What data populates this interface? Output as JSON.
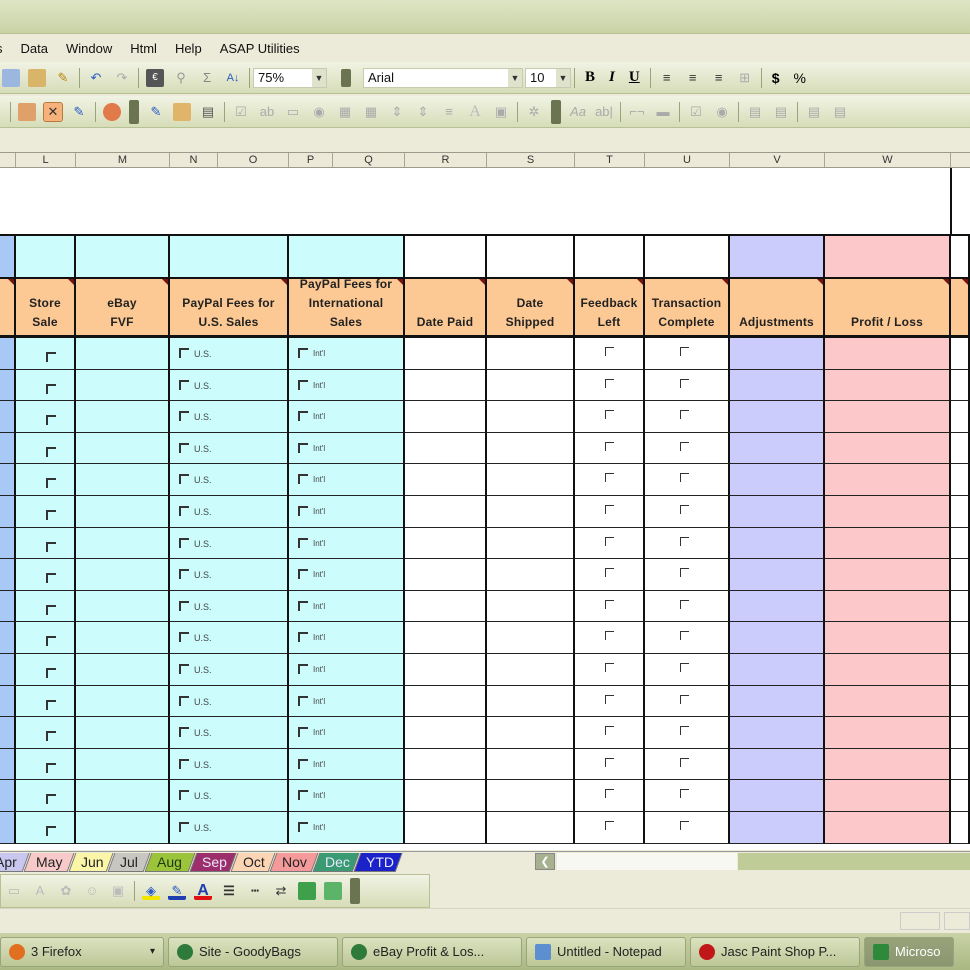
{
  "menubar": {
    "items": [
      "s",
      "Data",
      "Window",
      "Html",
      "Help",
      "ASAP Utilities"
    ]
  },
  "toolbar_standard": {
    "zoom_value": "75%",
    "font_name": "Arial",
    "font_size": "10",
    "bold_label": "B",
    "italic_label": "I",
    "underline_label": "U",
    "currency_label": "$",
    "percent_label": "%",
    "autosum_label": "Σ"
  },
  "column_headers": [
    "L",
    "M",
    "N",
    "O",
    "P",
    "Q",
    "R",
    "S",
    "T",
    "U",
    "V",
    "W"
  ],
  "table": {
    "headers": [
      {
        "key": "store_sale",
        "label": "Store Sale"
      },
      {
        "key": "ebay_fvf",
        "label": "eBay FVF"
      },
      {
        "key": "paypal_us",
        "label": "PayPal Fees for U.S. Sales"
      },
      {
        "key": "paypal_intl",
        "label": "PayPal Fees for International Sales"
      },
      {
        "key": "date_paid",
        "label": "Date Paid"
      },
      {
        "key": "date_shipped",
        "label": "Date Shipped"
      },
      {
        "key": "feedback_left",
        "label": "Feedback Left"
      },
      {
        "key": "transaction_complete",
        "label": "Transaction Complete"
      },
      {
        "key": "adjustments",
        "label": "Adjustments"
      },
      {
        "key": "profit_loss",
        "label": "Profit / Loss"
      }
    ],
    "checkbox_labels": {
      "us": "U.S.",
      "intl": "Int'l"
    },
    "row_count": 16
  },
  "sheet_tabs": [
    {
      "label": "Apr",
      "color": "#c9c7f0"
    },
    {
      "label": "May",
      "color": "#f7c9c9"
    },
    {
      "label": "Jun",
      "color": "#fbf5a8"
    },
    {
      "label": "Jul",
      "color": "#c8c6c0"
    },
    {
      "label": "Aug",
      "color": "#9cc43b"
    },
    {
      "label": "Sep",
      "color": "#9c2f6b"
    },
    {
      "label": "Oct",
      "color": "#fcd6b4"
    },
    {
      "label": "Nov",
      "color": "#f59a9a"
    },
    {
      "label": "Dec",
      "color": "#3a9a72"
    },
    {
      "label": "YTD",
      "color": "#1b22c8"
    }
  ],
  "colors": {
    "header_orange": "#fcc994",
    "cyan_fill": "#ccfcfc",
    "blue_fill": "#a8c8f5",
    "lavender_fill": "#ccccfc",
    "pink_fill": "#fcc8ca"
  },
  "taskbar": {
    "items": [
      {
        "label": "3 Firefox",
        "icon": "firefox-icon"
      },
      {
        "label": "Site - GoodyBags",
        "icon": "ftp-icon"
      },
      {
        "label": "eBay Profit & Los...",
        "icon": "ftp-icon"
      },
      {
        "label": "Untitled - Notepad",
        "icon": "notepad-icon"
      },
      {
        "label": "Jasc Paint Shop P...",
        "icon": "paintshop-icon"
      },
      {
        "label": "Microso",
        "icon": "excel-icon"
      }
    ]
  }
}
